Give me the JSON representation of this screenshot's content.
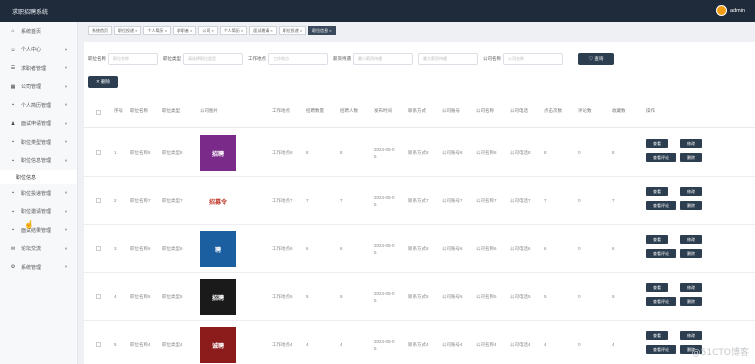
{
  "app": {
    "title": "求职招聘系统",
    "user": "admin"
  },
  "colors": {
    "topbar": "#1f2b3a",
    "button": "#2c3e50",
    "avatar": "#f39c12"
  },
  "sidebar": {
    "items": [
      {
        "label": "系统首页",
        "icon": "home-icon"
      },
      {
        "label": "个人中心",
        "icon": "user-icon"
      },
      {
        "label": "求职者管理",
        "icon": "list-icon"
      },
      {
        "label": "公司管理",
        "icon": "building-icon"
      },
      {
        "label": "个人简历管理",
        "icon": "grid-icon"
      },
      {
        "label": "面试申请管理",
        "icon": "person-icon"
      },
      {
        "label": "职位类型管理",
        "icon": "grid-icon"
      },
      {
        "label": "职位信息管理",
        "icon": "grid-icon",
        "expanded": true,
        "sub": "职位信息"
      },
      {
        "label": "职位投递管理",
        "icon": "grid-icon"
      },
      {
        "label": "职位邀请管理",
        "icon": "grid-icon"
      },
      {
        "label": "面试结果管理",
        "icon": "grid-icon"
      },
      {
        "label": "论坛交流",
        "icon": "chat-icon"
      },
      {
        "label": "系统管理",
        "icon": "settings-icon"
      }
    ]
  },
  "tabs": [
    "系统首页",
    "职位投递 ×",
    "个人简历 ×",
    "求职者 ×",
    "公司 ×",
    "个人简历 ×",
    "面试邀请 ×",
    "职位投递 ×",
    "职位信息 ×"
  ],
  "filters": {
    "position_name_label": "职位名称",
    "position_name_placeholder": "职位名称",
    "type_label": "职位类型",
    "type_placeholder": "请选择职位类型",
    "location_label": "工作地点",
    "location_placeholder": "工作地点",
    "salary_label": "薪资待遇",
    "salary_min_placeholder": "最小薪资待遇",
    "salary_max_placeholder": "最大薪资待遇",
    "company_label": "公司名称",
    "company_placeholder": "公司名称",
    "search_button": "♡ 查询"
  },
  "delete_button": "✕ 删除",
  "table": {
    "columns": [
      "序号",
      "职位名称",
      "职位类型",
      "公司图片",
      "工作地点",
      "招聘数量",
      "招聘人数",
      "发布时间",
      "联系方式",
      "公司账号",
      "公司名称",
      "公司电话",
      "点击次数",
      "评论数",
      "收藏数",
      "操作"
    ],
    "rows": [
      {
        "idx": "1",
        "name": "职位名称8",
        "type": "职位类型8",
        "loc": "工作地点8",
        "n1": "8",
        "n2": "8",
        "date": "2024-05-0 5",
        "contact": "联系方式8",
        "acct": "公司账号8",
        "company": "公司名称8",
        "phone": "公司电话8",
        "clicks": "8",
        "comments": "0",
        "favs": "8",
        "thumb_bg": "#7a2b8a",
        "thumb_text": "招聘"
      },
      {
        "idx": "2",
        "name": "职位名称7",
        "type": "职位类型7",
        "loc": "工作地点7",
        "n1": "7",
        "n2": "7",
        "date": "2024-05-0 5",
        "contact": "联系方式7",
        "acct": "公司账号7",
        "company": "公司名称7",
        "phone": "公司电话7",
        "clicks": "7",
        "comments": "0",
        "favs": "7",
        "thumb_bg": "#ffffff",
        "thumb_text": "招募令"
      },
      {
        "idx": "3",
        "name": "职位名称6",
        "type": "职位类型6",
        "loc": "工作地点6",
        "n1": "6",
        "n2": "6",
        "date": "2024-05-0 5",
        "contact": "联系方式6",
        "acct": "公司账号6",
        "company": "公司名称6",
        "phone": "公司电话6",
        "clicks": "6",
        "comments": "0",
        "favs": "6",
        "thumb_bg": "#1b5fa0",
        "thumb_text": "聘"
      },
      {
        "idx": "4",
        "name": "职位名称5",
        "type": "职位类型5",
        "loc": "工作地点5",
        "n1": "5",
        "n2": "5",
        "date": "2024-05-0 5",
        "contact": "联系方式5",
        "acct": "公司账号5",
        "company": "公司名称5",
        "phone": "公司电话5",
        "clicks": "5",
        "comments": "0",
        "favs": "5",
        "thumb_bg": "#1a1a1a",
        "thumb_text": "招聘"
      },
      {
        "idx": "5",
        "name": "职位名称4",
        "type": "职位类型4",
        "loc": "工作地点4",
        "n1": "4",
        "n2": "4",
        "date": "2024-05-0 5",
        "contact": "联系方式4",
        "acct": "公司账号4",
        "company": "公司名称4",
        "phone": "公司电话4",
        "clicks": "4",
        "comments": "0",
        "favs": "4",
        "thumb_bg": "#8c1b1b",
        "thumb_text": "诚聘"
      }
    ],
    "ops": {
      "view": "查看",
      "edit": "修改",
      "view_comments": "查看评论",
      "delete": "删除"
    }
  },
  "watermark": "@51CTO博客"
}
